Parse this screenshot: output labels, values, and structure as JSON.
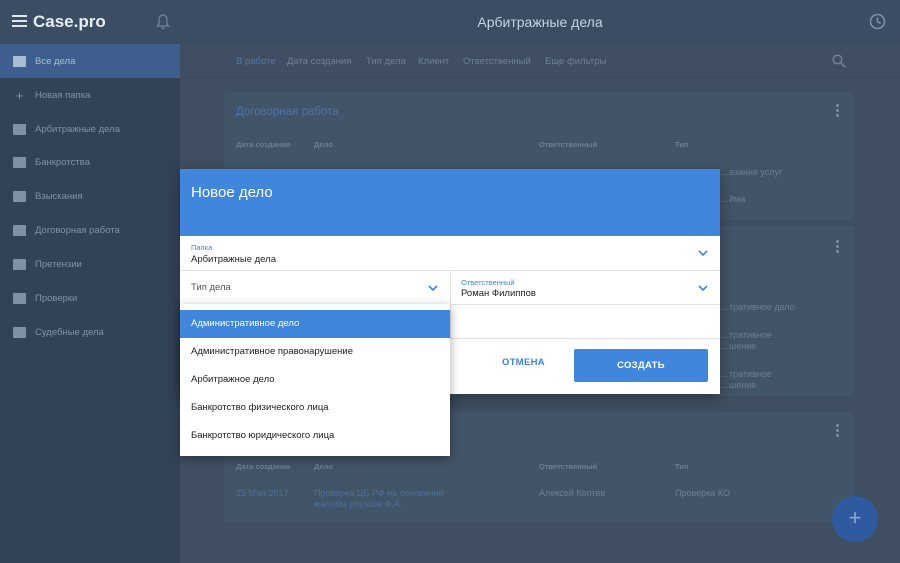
{
  "app": {
    "logo": "Case.pro",
    "title": "Арбитражные дела"
  },
  "sidebar": {
    "items": [
      {
        "label": "Все дела",
        "icon": "briefcase-icon",
        "active": true
      },
      {
        "label": "Новая папка",
        "icon": "plus-icon"
      },
      {
        "label": "Арбитражные дела",
        "icon": "folder-user-icon"
      },
      {
        "label": "Банкротства",
        "icon": "folder-user-icon"
      },
      {
        "label": "Взыскания",
        "icon": "folder-user-icon"
      },
      {
        "label": "Договорная работа",
        "icon": "folder-user-icon"
      },
      {
        "label": "Претензии",
        "icon": "folder-user-icon"
      },
      {
        "label": "Проверки",
        "icon": "folder-user-icon"
      },
      {
        "label": "Судебные дела",
        "icon": "folder-user-icon"
      }
    ]
  },
  "filters": [
    "В работе",
    "Дата создания",
    "Тип дела",
    "Клиент",
    "Ответственный",
    "Еще фильтры"
  ],
  "main": {
    "card1": {
      "title": "Договорная работа",
      "headers": [
        "Дата создания",
        "Дело",
        "Ответственный",
        "Тип"
      ],
      "partial": [
        "…азания услуг",
        "…йма"
      ]
    },
    "card2": {
      "partial": [
        "…тративное дело",
        "…тративное",
        "…шение",
        "…тративное",
        "…шение"
      ]
    },
    "card3": {
      "headers": [
        "Дата создания",
        "Дело",
        "Ответственный",
        "Тип"
      ],
      "row": {
        "date": "25 Мая 2017",
        "case": "Проверка ЦБ РФ на основании жалобы physical Ф.А.",
        "responsible": "Алексей Коптев",
        "type": "Проверка КО"
      }
    }
  },
  "dialog": {
    "title": "Новое дело",
    "folder_label": "Папка",
    "folder_value": "Арбитражные дела",
    "type_placeholder": "Тип дела",
    "responsible_label": "Ответственный",
    "responsible_value": "Роман Филиппов",
    "cancel": "ОТМЕНА",
    "create": "СОЗДАТЬ"
  },
  "dropdown": {
    "options": [
      "Административное дело",
      "Административное правонарушение",
      "Арбитражное дело",
      "Банкротство физического лица",
      "Банкротство юридического лица"
    ],
    "selected_index": 0
  },
  "colors": {
    "accent": "#3f86dc",
    "overlay": "#3a4d63"
  }
}
